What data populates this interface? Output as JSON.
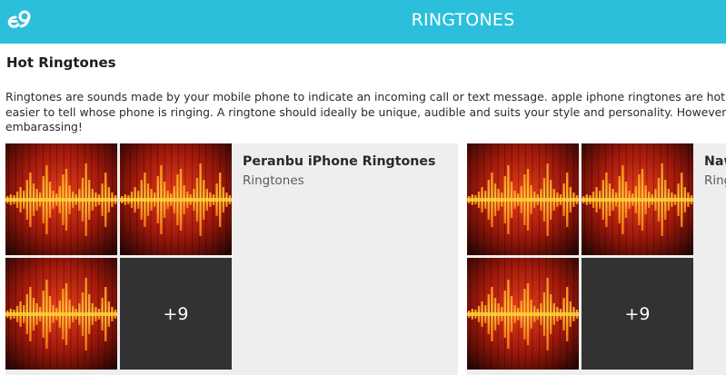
{
  "header": {
    "title": "RINGTONES",
    "logo_icon": "e9-logo-icon",
    "color": "#2bbfdc"
  },
  "section": {
    "title": "Hot Ringtones",
    "description_lines": [
      "Ringtones are sounds made by your mobile phone to indicate an incoming call or text message. apple iphone ringtones are hot bec",
      "easier to tell whose phone is ringing. A ringtone should ideally be unique, audible and suits your style and personality. However, the",
      "embarassing!"
    ]
  },
  "cards": [
    {
      "title": "Peranbu iPhone Ringtones",
      "category": "Ringtones",
      "more_label": "+9"
    },
    {
      "title": "Naw",
      "category": "Ring",
      "more_label": "+9"
    }
  ]
}
